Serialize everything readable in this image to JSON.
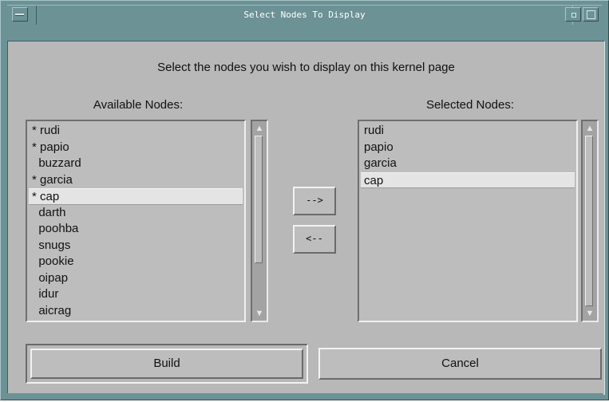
{
  "window": {
    "title": "Select Nodes To Display"
  },
  "dialog": {
    "instruction": "Select the nodes you wish to display on this kernel page",
    "available_label": "Available Nodes:",
    "selected_label": "Selected Nodes:",
    "available_nodes": [
      {
        "label": "* rudi",
        "selected": false
      },
      {
        "label": "* papio",
        "selected": false
      },
      {
        "label": "  buzzard",
        "selected": false
      },
      {
        "label": "* garcia",
        "selected": false
      },
      {
        "label": "* cap",
        "selected": true
      },
      {
        "label": "  darth",
        "selected": false
      },
      {
        "label": "  poohba",
        "selected": false
      },
      {
        "label": "  snugs",
        "selected": false
      },
      {
        "label": "  pookie",
        "selected": false
      },
      {
        "label": "  oipap",
        "selected": false
      },
      {
        "label": "  idur",
        "selected": false
      },
      {
        "label": "  aicrag",
        "selected": false
      }
    ],
    "selected_nodes": [
      {
        "label": "rudi",
        "selected": false
      },
      {
        "label": "papio",
        "selected": false
      },
      {
        "label": "garcia",
        "selected": false
      },
      {
        "label": "cap",
        "selected": true
      }
    ],
    "add_button": "-->",
    "remove_button": "<--",
    "build_button": "Build",
    "cancel_button": "Cancel"
  },
  "icons": {
    "scroll_up": "▲",
    "scroll_down": "▼"
  }
}
